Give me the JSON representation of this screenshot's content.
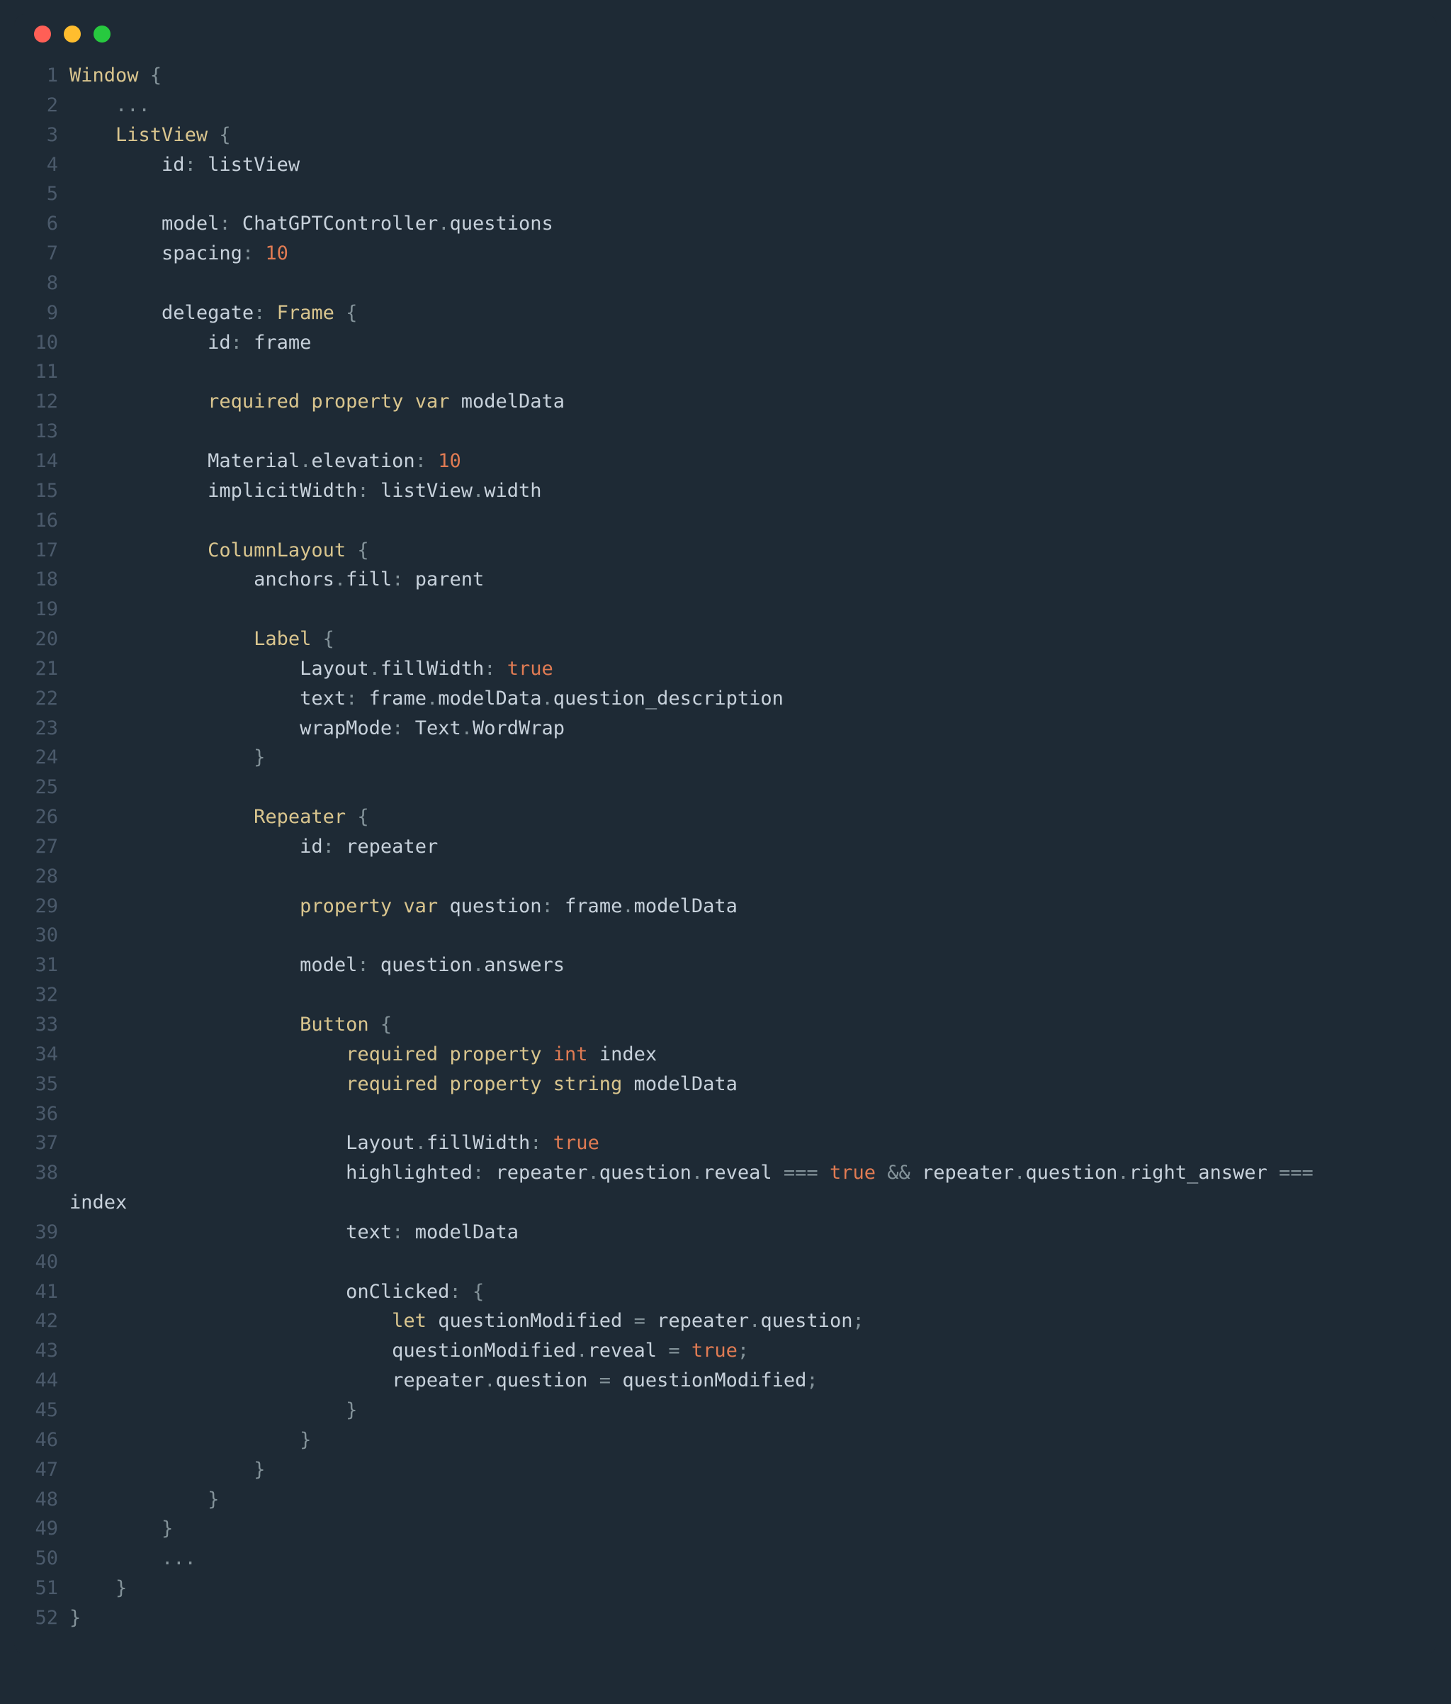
{
  "window": {
    "traffic_lights": [
      "close",
      "minimize",
      "maximize"
    ]
  },
  "gutter": {
    "start": 1,
    "end": 52
  },
  "code": {
    "1": {
      "indent": 0,
      "tokens": [
        [
          "type",
          "Window"
        ],
        [
          "sp",
          " "
        ],
        [
          "punc",
          "{"
        ]
      ]
    },
    "2": {
      "indent": 2,
      "tokens": [
        [
          "punc",
          "..."
        ]
      ]
    },
    "3": {
      "indent": 2,
      "tokens": [
        [
          "type",
          "ListView"
        ],
        [
          "sp",
          " "
        ],
        [
          "punc",
          "{"
        ]
      ]
    },
    "4": {
      "indent": 4,
      "tokens": [
        [
          "prop",
          "id"
        ],
        [
          "punc",
          ":"
        ],
        [
          "sp",
          " "
        ],
        [
          "id",
          "listView"
        ]
      ]
    },
    "5": {
      "indent": 0,
      "tokens": []
    },
    "6": {
      "indent": 4,
      "tokens": [
        [
          "prop",
          "model"
        ],
        [
          "punc",
          ":"
        ],
        [
          "sp",
          " "
        ],
        [
          "id",
          "ChatGPTController"
        ],
        [
          "punc",
          "."
        ],
        [
          "id",
          "questions"
        ]
      ]
    },
    "7": {
      "indent": 4,
      "tokens": [
        [
          "prop",
          "spacing"
        ],
        [
          "punc",
          ":"
        ],
        [
          "sp",
          " "
        ],
        [
          "num",
          "10"
        ]
      ]
    },
    "8": {
      "indent": 0,
      "tokens": []
    },
    "9": {
      "indent": 4,
      "tokens": [
        [
          "prop",
          "delegate"
        ],
        [
          "punc",
          ":"
        ],
        [
          "sp",
          " "
        ],
        [
          "type",
          "Frame"
        ],
        [
          "sp",
          " "
        ],
        [
          "punc",
          "{"
        ]
      ]
    },
    "10": {
      "indent": 6,
      "tokens": [
        [
          "prop",
          "id"
        ],
        [
          "punc",
          ":"
        ],
        [
          "sp",
          " "
        ],
        [
          "id",
          "frame"
        ]
      ]
    },
    "11": {
      "indent": 0,
      "tokens": []
    },
    "12": {
      "indent": 6,
      "tokens": [
        [
          "kw",
          "required"
        ],
        [
          "sp",
          " "
        ],
        [
          "kw",
          "property"
        ],
        [
          "sp",
          " "
        ],
        [
          "kw",
          "var"
        ],
        [
          "sp",
          " "
        ],
        [
          "id",
          "modelData"
        ]
      ]
    },
    "13": {
      "indent": 0,
      "tokens": []
    },
    "14": {
      "indent": 6,
      "tokens": [
        [
          "id",
          "Material"
        ],
        [
          "punc",
          "."
        ],
        [
          "prop",
          "elevation"
        ],
        [
          "punc",
          ":"
        ],
        [
          "sp",
          " "
        ],
        [
          "num",
          "10"
        ]
      ]
    },
    "15": {
      "indent": 6,
      "tokens": [
        [
          "prop",
          "implicitWidth"
        ],
        [
          "punc",
          ":"
        ],
        [
          "sp",
          " "
        ],
        [
          "id",
          "listView"
        ],
        [
          "punc",
          "."
        ],
        [
          "id",
          "width"
        ]
      ]
    },
    "16": {
      "indent": 0,
      "tokens": []
    },
    "17": {
      "indent": 6,
      "tokens": [
        [
          "type",
          "ColumnLayout"
        ],
        [
          "sp",
          " "
        ],
        [
          "punc",
          "{"
        ]
      ]
    },
    "18": {
      "indent": 8,
      "tokens": [
        [
          "id",
          "anchors"
        ],
        [
          "punc",
          "."
        ],
        [
          "prop",
          "fill"
        ],
        [
          "punc",
          ":"
        ],
        [
          "sp",
          " "
        ],
        [
          "id",
          "parent"
        ]
      ]
    },
    "19": {
      "indent": 0,
      "tokens": []
    },
    "20": {
      "indent": 8,
      "tokens": [
        [
          "type",
          "Label"
        ],
        [
          "sp",
          " "
        ],
        [
          "punc",
          "{"
        ]
      ]
    },
    "21": {
      "indent": 10,
      "tokens": [
        [
          "id",
          "Layout"
        ],
        [
          "punc",
          "."
        ],
        [
          "prop",
          "fillWidth"
        ],
        [
          "punc",
          ":"
        ],
        [
          "sp",
          " "
        ],
        [
          "bool",
          "true"
        ]
      ]
    },
    "22": {
      "indent": 10,
      "tokens": [
        [
          "prop",
          "text"
        ],
        [
          "punc",
          ":"
        ],
        [
          "sp",
          " "
        ],
        [
          "id",
          "frame"
        ],
        [
          "punc",
          "."
        ],
        [
          "id",
          "modelData"
        ],
        [
          "punc",
          "."
        ],
        [
          "id",
          "question_description"
        ]
      ]
    },
    "23": {
      "indent": 10,
      "tokens": [
        [
          "prop",
          "wrapMode"
        ],
        [
          "punc",
          ":"
        ],
        [
          "sp",
          " "
        ],
        [
          "id",
          "Text"
        ],
        [
          "punc",
          "."
        ],
        [
          "id",
          "WordWrap"
        ]
      ]
    },
    "24": {
      "indent": 8,
      "tokens": [
        [
          "punc",
          "}"
        ]
      ]
    },
    "25": {
      "indent": 0,
      "tokens": []
    },
    "26": {
      "indent": 8,
      "tokens": [
        [
          "type",
          "Repeater"
        ],
        [
          "sp",
          " "
        ],
        [
          "punc",
          "{"
        ]
      ]
    },
    "27": {
      "indent": 10,
      "tokens": [
        [
          "prop",
          "id"
        ],
        [
          "punc",
          ":"
        ],
        [
          "sp",
          " "
        ],
        [
          "id",
          "repeater"
        ]
      ]
    },
    "28": {
      "indent": 0,
      "tokens": []
    },
    "29": {
      "indent": 10,
      "tokens": [
        [
          "kw",
          "property"
        ],
        [
          "sp",
          " "
        ],
        [
          "kw",
          "var"
        ],
        [
          "sp",
          " "
        ],
        [
          "id",
          "question"
        ],
        [
          "punc",
          ":"
        ],
        [
          "sp",
          " "
        ],
        [
          "id",
          "frame"
        ],
        [
          "punc",
          "."
        ],
        [
          "id",
          "modelData"
        ]
      ]
    },
    "30": {
      "indent": 0,
      "tokens": []
    },
    "31": {
      "indent": 10,
      "tokens": [
        [
          "prop",
          "model"
        ],
        [
          "punc",
          ":"
        ],
        [
          "sp",
          " "
        ],
        [
          "id",
          "question"
        ],
        [
          "punc",
          "."
        ],
        [
          "id",
          "answers"
        ]
      ]
    },
    "32": {
      "indent": 0,
      "tokens": []
    },
    "33": {
      "indent": 10,
      "tokens": [
        [
          "type",
          "Button"
        ],
        [
          "sp",
          " "
        ],
        [
          "punc",
          "{"
        ]
      ]
    },
    "34": {
      "indent": 12,
      "tokens": [
        [
          "kw",
          "required"
        ],
        [
          "sp",
          " "
        ],
        [
          "kw",
          "property"
        ],
        [
          "sp",
          " "
        ],
        [
          "int",
          "int"
        ],
        [
          "sp",
          " "
        ],
        [
          "id",
          "index"
        ]
      ]
    },
    "35": {
      "indent": 12,
      "tokens": [
        [
          "kw",
          "required"
        ],
        [
          "sp",
          " "
        ],
        [
          "kw",
          "property"
        ],
        [
          "sp",
          " "
        ],
        [
          "kw",
          "string"
        ],
        [
          "sp",
          " "
        ],
        [
          "id",
          "modelData"
        ]
      ]
    },
    "36": {
      "indent": 0,
      "tokens": []
    },
    "37": {
      "indent": 12,
      "tokens": [
        [
          "id",
          "Layout"
        ],
        [
          "punc",
          "."
        ],
        [
          "prop",
          "fillWidth"
        ],
        [
          "punc",
          ":"
        ],
        [
          "sp",
          " "
        ],
        [
          "bool",
          "true"
        ]
      ]
    },
    "38": {
      "indent": 12,
      "tokens": [
        [
          "prop",
          "highlighted"
        ],
        [
          "punc",
          ":"
        ],
        [
          "sp",
          " "
        ],
        [
          "id",
          "repeater"
        ],
        [
          "punc",
          "."
        ],
        [
          "id",
          "question"
        ],
        [
          "punc",
          "."
        ],
        [
          "id",
          "reveal"
        ],
        [
          "sp",
          " "
        ],
        [
          "op",
          "==="
        ],
        [
          "sp",
          " "
        ],
        [
          "bool",
          "true"
        ],
        [
          "sp",
          " "
        ],
        [
          "op",
          "&&"
        ],
        [
          "sp",
          " "
        ],
        [
          "id",
          "repeater"
        ],
        [
          "punc",
          "."
        ],
        [
          "id",
          "question"
        ],
        [
          "punc",
          "."
        ],
        [
          "id",
          "right_answer"
        ],
        [
          "sp",
          " "
        ],
        [
          "op",
          "==="
        ]
      ]
    },
    "38b": {
      "indent": 0,
      "tokens": [
        [
          "id",
          "index"
        ]
      ]
    },
    "39": {
      "indent": 12,
      "tokens": [
        [
          "prop",
          "text"
        ],
        [
          "punc",
          ":"
        ],
        [
          "sp",
          " "
        ],
        [
          "id",
          "modelData"
        ]
      ]
    },
    "40": {
      "indent": 0,
      "tokens": []
    },
    "41": {
      "indent": 12,
      "tokens": [
        [
          "prop",
          "onClicked"
        ],
        [
          "punc",
          ":"
        ],
        [
          "sp",
          " "
        ],
        [
          "punc",
          "{"
        ]
      ]
    },
    "42": {
      "indent": 14,
      "tokens": [
        [
          "kw",
          "let"
        ],
        [
          "sp",
          " "
        ],
        [
          "id",
          "questionModified"
        ],
        [
          "sp",
          " "
        ],
        [
          "op",
          "="
        ],
        [
          "sp",
          " "
        ],
        [
          "id",
          "repeater"
        ],
        [
          "punc",
          "."
        ],
        [
          "id",
          "question"
        ],
        [
          "punc",
          ";"
        ]
      ]
    },
    "43": {
      "indent": 14,
      "tokens": [
        [
          "id",
          "questionModified"
        ],
        [
          "punc",
          "."
        ],
        [
          "id",
          "reveal"
        ],
        [
          "sp",
          " "
        ],
        [
          "op",
          "="
        ],
        [
          "sp",
          " "
        ],
        [
          "bool",
          "true"
        ],
        [
          "punc",
          ";"
        ]
      ]
    },
    "44": {
      "indent": 14,
      "tokens": [
        [
          "id",
          "repeater"
        ],
        [
          "punc",
          "."
        ],
        [
          "id",
          "question"
        ],
        [
          "sp",
          " "
        ],
        [
          "op",
          "="
        ],
        [
          "sp",
          " "
        ],
        [
          "id",
          "questionModified"
        ],
        [
          "punc",
          ";"
        ]
      ]
    },
    "45": {
      "indent": 12,
      "tokens": [
        [
          "punc",
          "}"
        ]
      ]
    },
    "46": {
      "indent": 10,
      "tokens": [
        [
          "punc",
          "}"
        ]
      ]
    },
    "47": {
      "indent": 8,
      "tokens": [
        [
          "punc",
          "}"
        ]
      ]
    },
    "48": {
      "indent": 6,
      "tokens": [
        [
          "punc",
          "}"
        ]
      ]
    },
    "49": {
      "indent": 4,
      "tokens": [
        [
          "punc",
          "}"
        ]
      ]
    },
    "50": {
      "indent": 4,
      "tokens": [
        [
          "punc",
          "..."
        ]
      ]
    },
    "51": {
      "indent": 2,
      "tokens": [
        [
          "punc",
          "}"
        ]
      ]
    },
    "52": {
      "indent": 0,
      "tokens": [
        [
          "punc",
          "}"
        ]
      ]
    }
  },
  "line_order": [
    "1",
    "2",
    "3",
    "4",
    "5",
    "6",
    "7",
    "8",
    "9",
    "10",
    "11",
    "12",
    "13",
    "14",
    "15",
    "16",
    "17",
    "18",
    "19",
    "20",
    "21",
    "22",
    "23",
    "24",
    "25",
    "26",
    "27",
    "28",
    "29",
    "30",
    "31",
    "32",
    "33",
    "34",
    "35",
    "36",
    "37",
    "38",
    "38b",
    "39",
    "40",
    "41",
    "42",
    "43",
    "44",
    "45",
    "46",
    "47",
    "48",
    "49",
    "50",
    "51",
    "52"
  ]
}
